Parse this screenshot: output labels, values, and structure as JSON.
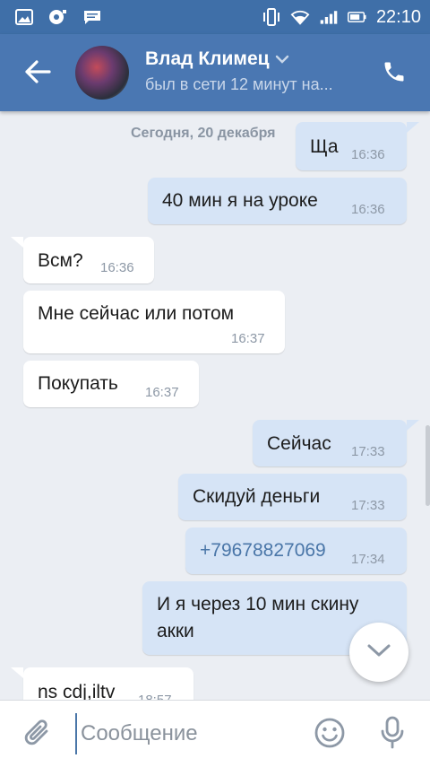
{
  "status_bar": {
    "time": "22:10",
    "icons": [
      "gallery-icon",
      "media-icon",
      "message-icon",
      "vibrate-icon",
      "wifi-icon",
      "signal-icon",
      "battery-icon"
    ]
  },
  "header": {
    "back_icon": "arrow-left-icon",
    "contact_name": "Влад Климец",
    "contact_status": "был в сети 12 минут на...",
    "call_icon": "phone-icon",
    "accent_color": "#4a77b2"
  },
  "chat": {
    "date_separator": "Сегодня, 20 декабря",
    "messages": [
      {
        "dir": "out",
        "text": "Ща",
        "time": "16:36"
      },
      {
        "dir": "out",
        "text": "40 мин я на уроке",
        "time": "16:36"
      },
      {
        "dir": "in",
        "text": "Всм?",
        "time": "16:36"
      },
      {
        "dir": "in",
        "text": "Мне сейчас или потом",
        "time": "16:37"
      },
      {
        "dir": "in",
        "text": "Покупать",
        "time": "16:37"
      },
      {
        "dir": "out",
        "text": "Сейчас",
        "time": "17:33"
      },
      {
        "dir": "out",
        "text": "Скидуй деньги",
        "time": "17:33"
      },
      {
        "dir": "out",
        "text": "+79678827069",
        "time": "17:34"
      },
      {
        "dir": "out",
        "text_line1": "И я через 10 мин скину",
        "text_line2": "акки",
        "time": ""
      },
      {
        "dir": "in",
        "text": "ns cdj,iltv",
        "time": "18:57"
      }
    ],
    "bubble_in_color": "#ffffff",
    "bubble_out_color": "#d6e4f6",
    "link_color": "#4a76a8"
  },
  "composer": {
    "placeholder": "Сообщение",
    "value": "",
    "attach_icon": "paperclip-icon",
    "emoji_icon": "smiley-icon",
    "mic_icon": "microphone-icon"
  }
}
